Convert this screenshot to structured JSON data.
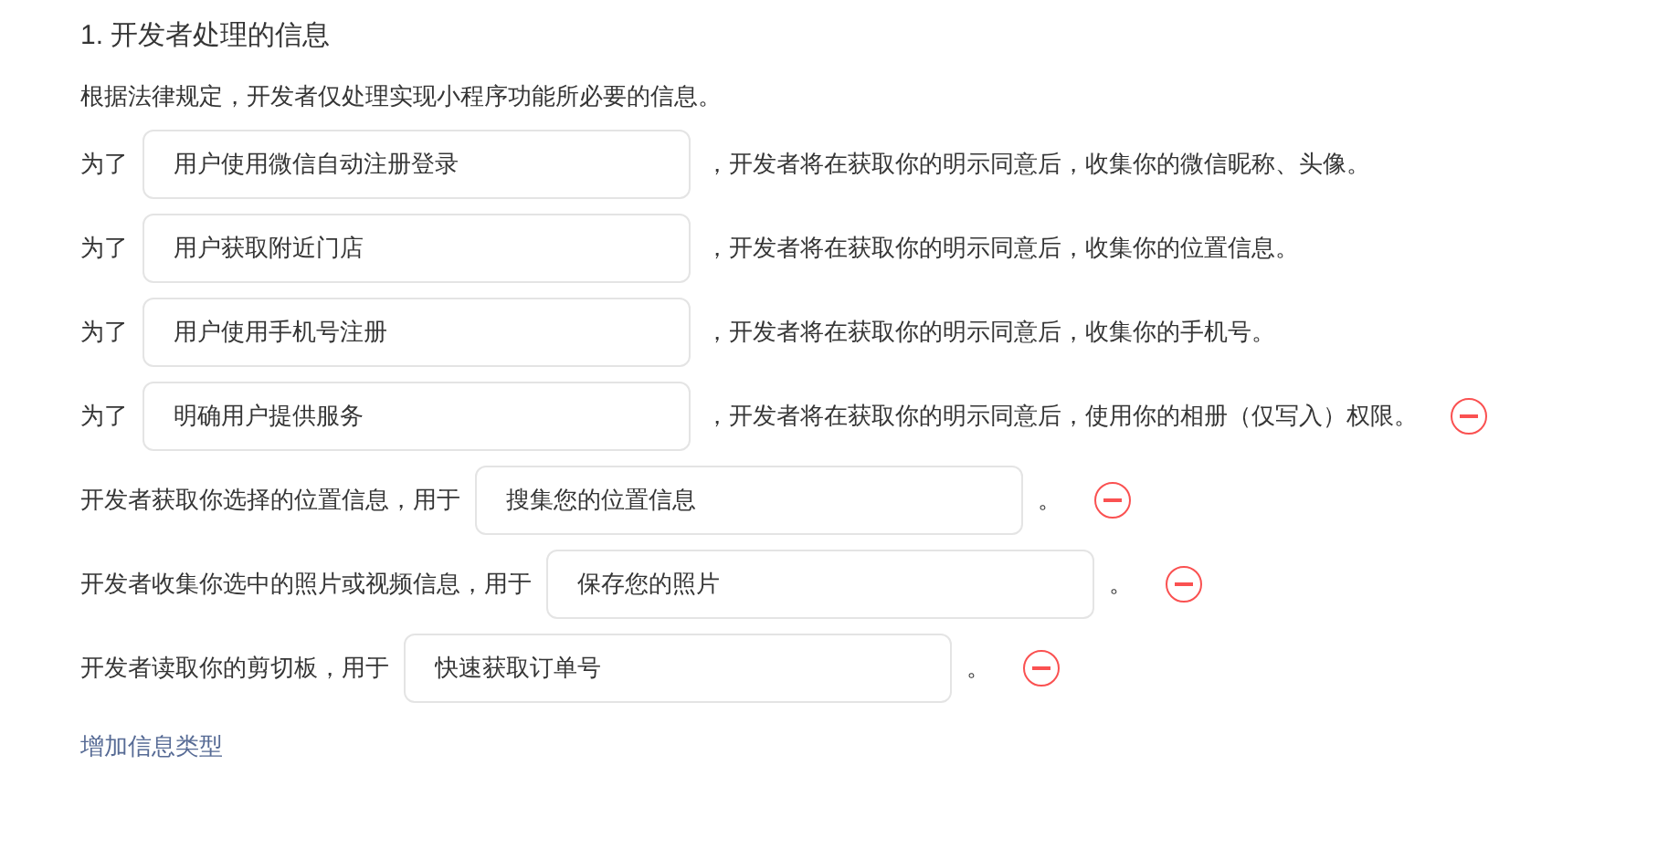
{
  "section_title": "1. 开发者处理的信息",
  "intro": "根据法律规定，开发者仅处理实现小程序功能所必要的信息。",
  "rows": [
    {
      "prefix": "为了",
      "value": "用户使用微信自动注册登录",
      "suffix": "，开发者将在获取你的明示同意后，收集你的微信昵称、头像。",
      "removable": false
    },
    {
      "prefix": "为了",
      "value": "用户获取附近门店",
      "suffix": "，开发者将在获取你的明示同意后，收集你的位置信息。",
      "removable": false
    },
    {
      "prefix": "为了",
      "value": "用户使用手机号注册",
      "suffix": "，开发者将在获取你的明示同意后，收集你的手机号。",
      "removable": false
    },
    {
      "prefix": "为了",
      "value": "明确用户提供服务",
      "suffix": "，开发者将在获取你的明示同意后，使用你的相册（仅写入）权限。",
      "removable": true
    },
    {
      "prefix": "开发者获取你选择的位置信息，用于",
      "value": "搜集您的位置信息",
      "suffix": "。",
      "removable": true
    },
    {
      "prefix": "开发者收集你选中的照片或视频信息，用于",
      "value": "保存您的照片",
      "suffix": "。",
      "removable": true
    },
    {
      "prefix": "开发者读取你的剪切板，用于",
      "value": "快速获取订单号",
      "suffix": "。",
      "removable": true
    }
  ],
  "add_link": "增加信息类型"
}
